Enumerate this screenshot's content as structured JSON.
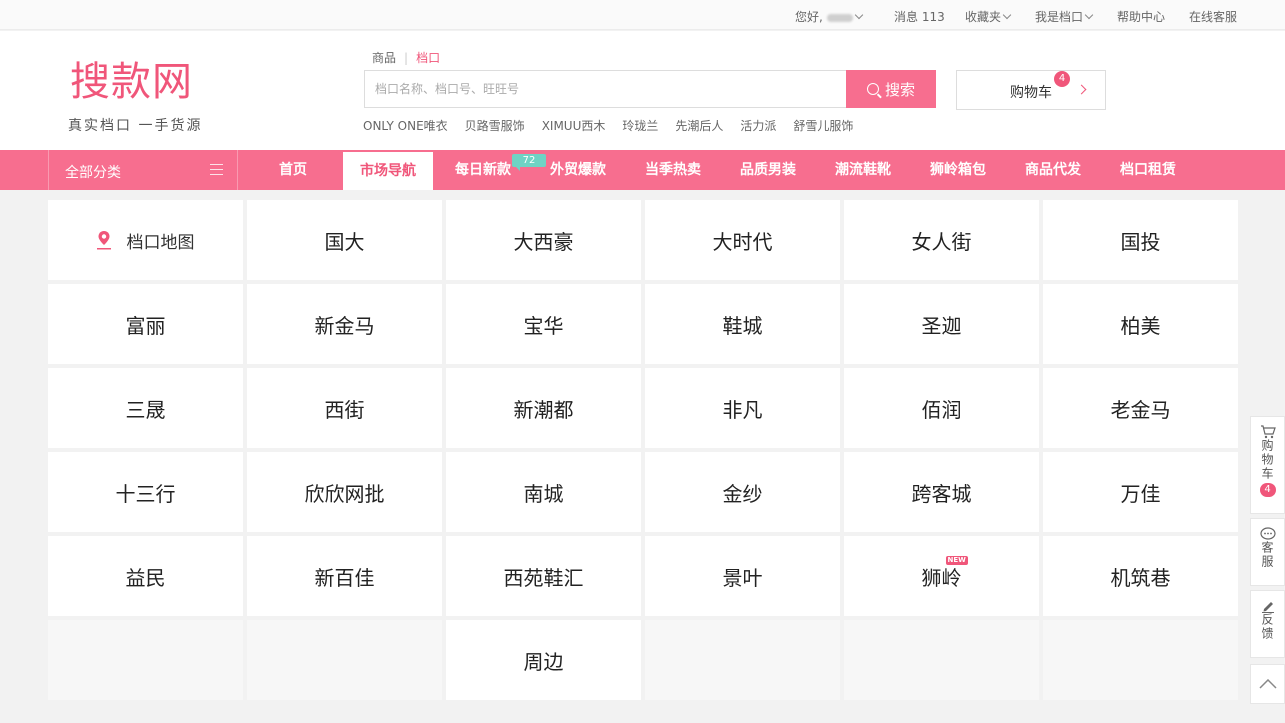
{
  "topbar": {
    "greeting": "您好,",
    "messages": "消息 113",
    "favorites": "收藏夹",
    "my_stall": "我是档口",
    "help": "帮助中心",
    "service": "在线客服"
  },
  "header": {
    "logo": "搜款网",
    "slogan": "真实档口  一手货源",
    "search_tabs": [
      "商品",
      "档口"
    ],
    "search_active_tab": "档口",
    "search_placeholder": "档口名称、档口号、旺旺号",
    "search_button": "搜索",
    "cart_label": "购物车",
    "cart_count": "4",
    "hot_links": [
      "ONLY ONE唯衣",
      "贝路雪服饰",
      "XIMUU西木",
      "玲珑兰",
      "先潮后人",
      "活力派",
      "舒雪儿服饰"
    ]
  },
  "nav": {
    "all_categories": "全部分类",
    "items": [
      "首页",
      "市场导航",
      "每日新款",
      "外贸爆款",
      "当季热卖",
      "品质男装",
      "潮流鞋靴",
      "狮岭箱包",
      "商品代发",
      "档口租赁"
    ],
    "active": "市场导航",
    "new_badge": "72"
  },
  "markets": {
    "map_label": "档口地图",
    "rows": [
      [
        "国大",
        "大西豪",
        "大时代",
        "女人街",
        "国投"
      ],
      [
        "富丽",
        "新金马",
        "宝华",
        "鞋城",
        "圣迦",
        "柏美"
      ],
      [
        "三晟",
        "西街",
        "新潮都",
        "非凡",
        "佰润",
        "老金马"
      ],
      [
        "十三行",
        "欣欣网批",
        "南城",
        "金纱",
        "跨客城",
        "万佳"
      ],
      [
        "益民",
        "新百佳",
        "西苑鞋汇",
        "景叶",
        "狮岭",
        "机筑巷"
      ],
      [
        "周边"
      ]
    ],
    "new_tag": "NEW"
  },
  "side": {
    "cart": "购物车",
    "cart_count": "4",
    "service": "客服",
    "feedback": "反馈"
  },
  "colors": {
    "brand": "#f76e8f",
    "brand_dark": "#f0567a",
    "badge_teal": "#6fd3c4"
  }
}
